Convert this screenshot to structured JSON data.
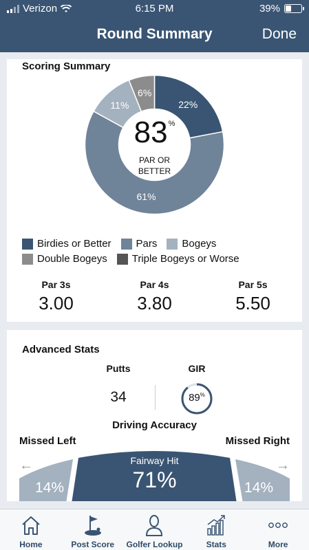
{
  "status_bar": {
    "carrier": "Verizon",
    "time": "6:15 PM",
    "battery": "39%",
    "battery_level": 0.39
  },
  "header": {
    "title": "Round Summary",
    "done_label": "Done"
  },
  "scoring": {
    "title": "Scoring Summary",
    "center_value": "83",
    "center_unit": "%",
    "center_line1": "PAR OR",
    "center_line2": "BETTER",
    "slices": [
      {
        "name": "Birdies or Better",
        "percent": 22,
        "label": "22%",
        "color": "#3a5573"
      },
      {
        "name": "Pars",
        "percent": 61,
        "label": "61%",
        "color": "#6f8399"
      },
      {
        "name": "Bogeys",
        "percent": 11,
        "label": "11%",
        "color": "#a4b1bf"
      },
      {
        "name": "Double Bogeys",
        "percent": 6,
        "label": "6%",
        "color": "#8c8c8c"
      },
      {
        "name": "Triple Bogeys or Worse",
        "percent": 0,
        "label": "",
        "color": "#555555"
      }
    ],
    "legend": [
      "Birdies or Better",
      "Pars",
      "Bogeys",
      "Double Bogeys",
      "Triple Bogeys or Worse"
    ],
    "pars": [
      {
        "label": "Par 3s",
        "value": "3.00"
      },
      {
        "label": "Par 4s",
        "value": "3.80"
      },
      {
        "label": "Par 5s",
        "value": "5.50"
      }
    ]
  },
  "advanced": {
    "title": "Advanced Stats",
    "putts_label": "Putts",
    "putts_value": "34",
    "gir_label": "GIR",
    "gir_value": "89",
    "gir_unit": "%",
    "gir_percent": 89,
    "driving_title": "Driving Accuracy",
    "missed_left_label": "Missed Left",
    "missed_right_label": "Missed Right",
    "missed_left_value": "14%",
    "missed_right_value": "14%",
    "fairway_label": "Fairway Hit",
    "fairway_value": "71%"
  },
  "tabs": [
    {
      "label": "Home",
      "icon": "home-icon"
    },
    {
      "label": "Post Score",
      "icon": "golf-flag-icon"
    },
    {
      "label": "Golfer Lookup",
      "icon": "person-icon"
    },
    {
      "label": "Stats",
      "icon": "stats-chart-icon"
    },
    {
      "label": "More",
      "icon": "more-dots-icon"
    }
  ],
  "colors": {
    "brand": "#3a5573",
    "card": "#ffffff",
    "background": "#e8ecf0"
  }
}
